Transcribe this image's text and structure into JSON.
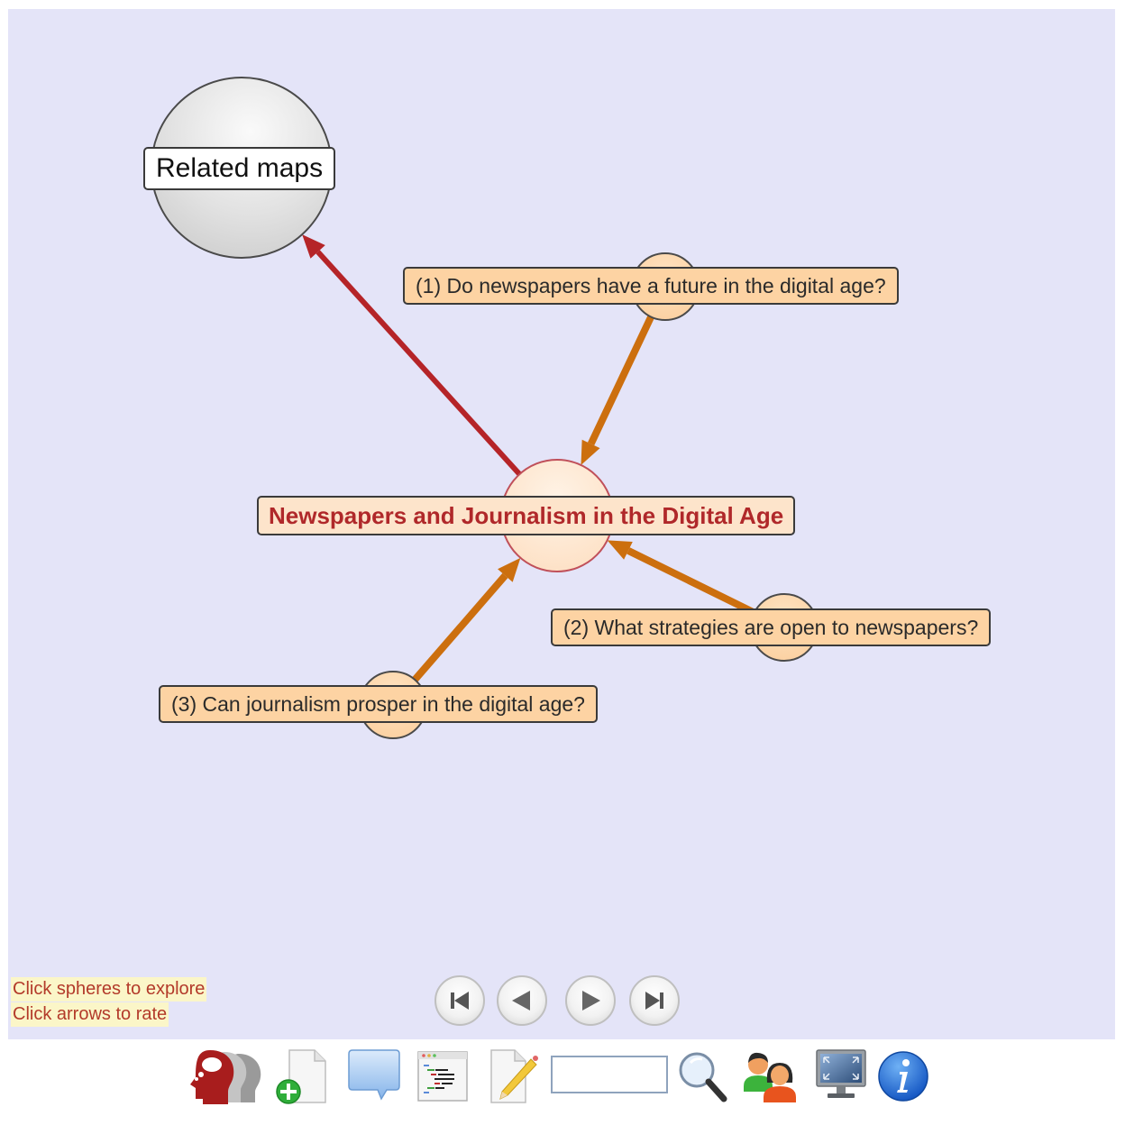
{
  "map": {
    "central_node": {
      "label": "Newspapers and Journalism in the Digital Age"
    },
    "related_node": {
      "label": "Related maps"
    },
    "question_nodes": [
      {
        "label": "(1) Do newspapers have a future in the digital age?"
      },
      {
        "label": "(2) What strategies are open to newspapers?"
      },
      {
        "label": "(3) Can journalism prosper in the digital age?"
      }
    ],
    "links": [
      {
        "from": "central",
        "to": "related",
        "color": "#b52428"
      },
      {
        "from": "q1",
        "to": "central",
        "color": "#cc6f0e"
      },
      {
        "from": "q2",
        "to": "central",
        "color": "#cc6f0e"
      },
      {
        "from": "q3",
        "to": "central",
        "color": "#cc6f0e"
      }
    ]
  },
  "hints": [
    "Click spheres to explore",
    "Click arrows to rate"
  ],
  "navigation": {
    "buttons": [
      {
        "name": "first",
        "icon": "skip-first-icon"
      },
      {
        "name": "previous",
        "icon": "previous-icon"
      },
      {
        "name": "next",
        "icon": "next-icon"
      },
      {
        "name": "last",
        "icon": "skip-last-icon"
      }
    ]
  },
  "toolbar": {
    "items": [
      {
        "name": "home-logo",
        "icon": "heads-logo-icon"
      },
      {
        "name": "new-map",
        "icon": "new-document-icon"
      },
      {
        "name": "comment",
        "icon": "speech-bubble-icon"
      },
      {
        "name": "source-view",
        "icon": "code-window-icon"
      },
      {
        "name": "edit",
        "icon": "edit-document-icon"
      },
      {
        "name": "search",
        "icon": "magnifier-icon"
      },
      {
        "name": "users",
        "icon": "users-icon"
      },
      {
        "name": "fullscreen",
        "icon": "fullscreen-monitor-icon"
      },
      {
        "name": "info",
        "icon": "info-icon"
      }
    ],
    "search": {
      "value": "",
      "placeholder": ""
    }
  },
  "colors": {
    "canvas_bg": "#e4e4f8",
    "question_fill": "#fdd3a3",
    "central_text": "#b0282a",
    "related_arrow": "#b52428",
    "question_arrow": "#cc6f0e",
    "hint_text": "#b33a2a",
    "hint_bg": "#fbf6c8"
  }
}
